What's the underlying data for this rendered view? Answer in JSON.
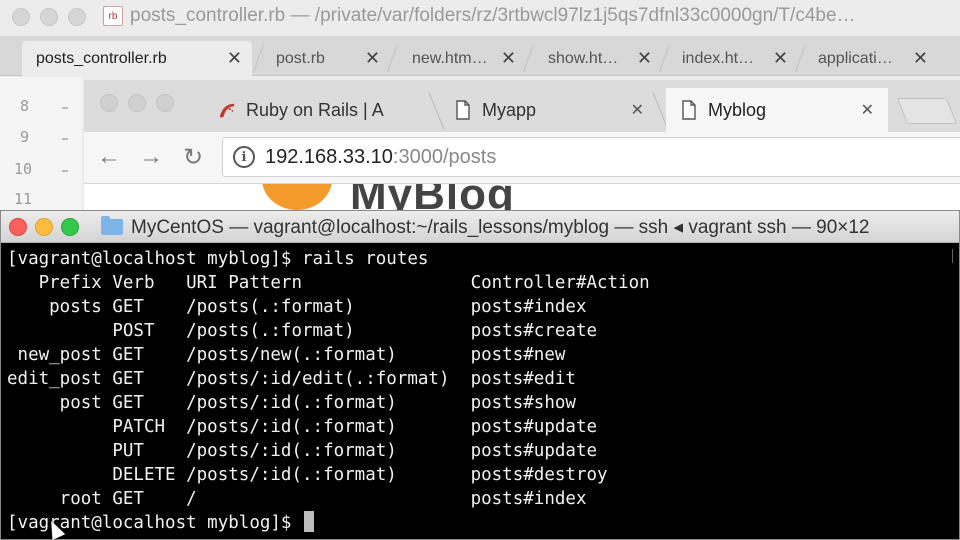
{
  "editor": {
    "title": "posts_controller.rb — /private/var/folders/rz/3rtbwcl97lz1j5qs7dfnl33c0000gn/T/c4be…",
    "file_icon_label": "rb",
    "tabs": [
      {
        "label": "posts_controller.rb",
        "close": "✕"
      },
      {
        "label": "post.rb",
        "close": "✕"
      },
      {
        "label": "new.htm…",
        "close": "✕"
      },
      {
        "label": "show.ht…",
        "close": "✕"
      },
      {
        "label": "index.ht…",
        "close": "✕"
      },
      {
        "label": "applicati…",
        "close": "✕"
      }
    ],
    "line_numbers": [
      "8",
      "9",
      "10",
      "11"
    ]
  },
  "browser": {
    "tabs": [
      {
        "label": "Ruby on Rails | A",
        "close": "✕"
      },
      {
        "label": "Myapp",
        "close": "✕"
      },
      {
        "label": "Myblog",
        "close": "✕"
      }
    ],
    "nav": {
      "back": "←",
      "forward": "→",
      "reload": "↻"
    },
    "url_host": "192.168.33.10",
    "url_rest": ":3000/posts",
    "info_glyph": "i",
    "page_logo_text": "MyBlog"
  },
  "terminal": {
    "title": "MyCentOS — vagrant@localhost:~/rails_lessons/myblog — ssh ◂ vagrant ssh — 90×12",
    "lines": [
      "[vagrant@localhost myblog]$ rails routes",
      "   Prefix Verb   URI Pattern                Controller#Action",
      "    posts GET    /posts(.:format)           posts#index",
      "          POST   /posts(.:format)           posts#create",
      " new_post GET    /posts/new(.:format)       posts#new",
      "edit_post GET    /posts/:id/edit(.:format)  posts#edit",
      "     post GET    /posts/:id(.:format)       posts#show",
      "          PATCH  /posts/:id(.:format)       posts#update",
      "          PUT    /posts/:id(.:format)       posts#update",
      "          DELETE /posts/:id(.:format)       posts#destroy",
      "     root GET    /                          posts#index"
    ],
    "prompt": "[vagrant@localhost myblog]$ "
  },
  "colors": {
    "terminal_bg": "#000000",
    "terminal_fg": "#f2f2f2",
    "close_red": "#fc605c",
    "minimize_yellow": "#fdbc40",
    "zoom_green": "#34c84a",
    "logo_orange": "#f39a2b"
  }
}
